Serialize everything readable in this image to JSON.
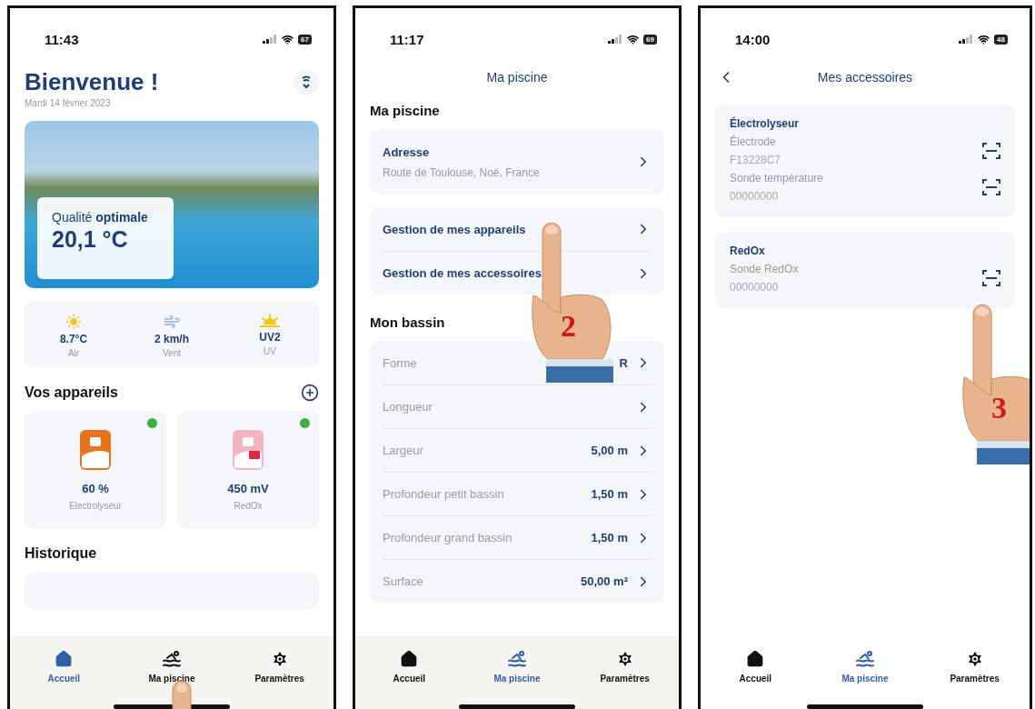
{
  "home_screen": {
    "status_bar": {
      "time": "11:43",
      "battery": "67"
    },
    "title": "Bienvenue !",
    "date": "Mardi 14 février 2023",
    "hero": {
      "quality": "Qualité **optimale**",
      "temperature": "20,1 °C"
    },
    "weather": [
      {
        "kind": "sun",
        "value": "8.7°C",
        "label": "Air"
      },
      {
        "kind": "wind",
        "value": "2 km/h",
        "label": "Vent"
      },
      {
        "kind": "uv",
        "value": "UV2",
        "label": "UV"
      }
    ],
    "devices_title": "Vos appareils",
    "devices": [
      {
        "kind": "electrolyser",
        "value": "60 %",
        "label": "Electrolyseur",
        "color": "#3cb043"
      },
      {
        "kind": "redox",
        "value": "450 mV",
        "label": "RedOx",
        "color": "#3cb043"
      }
    ],
    "history_title": "Historique",
    "tabs": [
      {
        "kind": "home",
        "label": "Accueil",
        "selected": true
      },
      {
        "kind": "pool",
        "label": "Ma piscine",
        "selected": false
      },
      {
        "kind": "settings",
        "label": "Paramètres",
        "selected": false
      }
    ],
    "pointer": {
      "kind": "fingertip"
    }
  },
  "pool_screen": {
    "status_bar": {
      "time": "11:17",
      "battery": "69"
    },
    "header": "Ma piscine",
    "section_1": "Ma piscine",
    "address": {
      "label": "Adresse",
      "value": "Route de Toulouse, Noé, France"
    },
    "links": [
      "Gestion de mes appareils",
      "Gestion de mes accessoires"
    ],
    "section_2": "Mon bassin",
    "rows": [
      {
        "label": "Forme",
        "value": "R"
      },
      {
        "label": "Longueur"
      },
      {
        "label": "Largeur",
        "value": "5,00 m"
      },
      {
        "label": "Profondeur petit bassin",
        "value": "1,50 m"
      },
      {
        "label": "Profondeur grand bassin",
        "value": "1,50 m"
      },
      {
        "label": "Surface",
        "value": "50,00 m²"
      }
    ],
    "tabs": [
      {
        "kind": "home",
        "label": "Accueil",
        "selected": false
      },
      {
        "kind": "pool",
        "label": "Ma piscine",
        "selected": true
      },
      {
        "kind": "settings",
        "label": "Paramètres",
        "selected": false
      }
    ],
    "pointer": {
      "kind": "hand",
      "step": "2"
    }
  },
  "accessories_screen": {
    "status_bar": {
      "time": "14:00",
      "battery": "48"
    },
    "header": "Mes accessoires",
    "groups": [
      {
        "title": "Électrolyseur",
        "items": [
          {
            "name": "Électrode",
            "serial": "F13228C7"
          },
          {
            "name": "Sonde température",
            "serial": "00000000"
          }
        ]
      },
      {
        "title": "RedOx",
        "items": [
          {
            "name": "Sonde RedOx",
            "serial": "00000000"
          }
        ]
      }
    ],
    "tabs": [
      {
        "kind": "home",
        "label": "Accueil",
        "selected": false
      },
      {
        "kind": "pool",
        "label": "Ma piscine",
        "selected": true
      },
      {
        "kind": "settings",
        "label": "Paramètres",
        "selected": false
      }
    ],
    "pointer": {
      "kind": "hand",
      "step": "3"
    }
  }
}
